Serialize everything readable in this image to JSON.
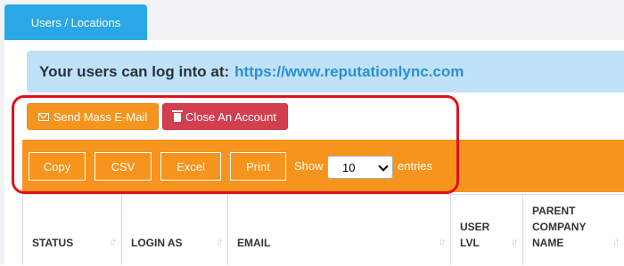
{
  "tab": {
    "label": "Users / Locations"
  },
  "banner": {
    "text": "Your users can log into at:",
    "url": "https://www.reputationlync.com"
  },
  "actions": {
    "send_mail": "Send Mass E-Mail",
    "close_account": "Close An Account"
  },
  "export": {
    "buttons": [
      "Copy",
      "CSV",
      "Excel",
      "Print"
    ]
  },
  "length": {
    "show_label": "Show",
    "value": "10",
    "entries_label": "entries"
  },
  "table": {
    "columns": [
      "STATUS",
      "LOGIN AS",
      "EMAIL",
      "USER LVL",
      "PARENT COMPANY NAME"
    ]
  },
  "colors": {
    "accent_orange": "#f7941d",
    "danger_red": "#d43f4f",
    "tab_blue": "#2aa7e6",
    "banner_blue": "#bfe2f9",
    "highlight_red": "#e0101a"
  }
}
